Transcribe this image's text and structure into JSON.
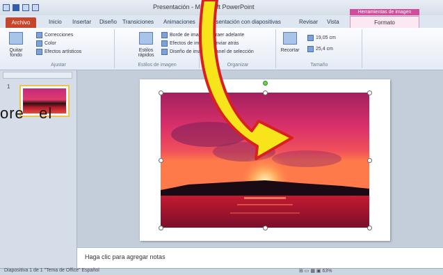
{
  "window": {
    "title": "Presentación - Microsoft PowerPoint",
    "context_tab_group": "Herramientas de imagen"
  },
  "ribbon_tabs": {
    "file": "Archivo",
    "tabs": [
      "Inicio",
      "Insertar",
      "Diseño",
      "Transiciones",
      "Animaciones",
      "Presentación con diapositivas",
      "Revisar",
      "Vista"
    ],
    "format": "Formato"
  },
  "ribbon_groups": {
    "adjust": {
      "label": "Ajustar",
      "big_button": "Quitar fondo",
      "items": [
        "Correcciones",
        "Color",
        "Efectos artísticos"
      ]
    },
    "picture_styles": {
      "label": "Estilos de imagen",
      "big_button": "Estilos rápidos",
      "items": [
        "Borde de imagen",
        "Efectos de imagen",
        "Diseño de imagen"
      ]
    },
    "arrange": {
      "label": "Organizar",
      "items": [
        "Traer adelante",
        "Enviar atrás",
        "Panel de selección"
      ]
    },
    "size": {
      "label": "Tamaño",
      "big_button": "Recortar",
      "height": "19,05 cm",
      "width": "25,4 cm"
    }
  },
  "slide_panel": {
    "slide_number": "1",
    "tabs_label": "Diapositivas"
  },
  "overlay_text": "ore   el",
  "notes": {
    "placeholder": "Haga clic para agregar notas"
  },
  "status_bar": {
    "left": "Diapositiva 1 de 1   \"Tema de Office\"   Español",
    "right": "⊞ ▭ ▦ ▣   63%"
  },
  "colors": {
    "file_tab": "#c7462b",
    "context_tab": "#d14c9a",
    "arrow_fill": "#f7e41a",
    "arrow_outline": "#d8201e"
  }
}
